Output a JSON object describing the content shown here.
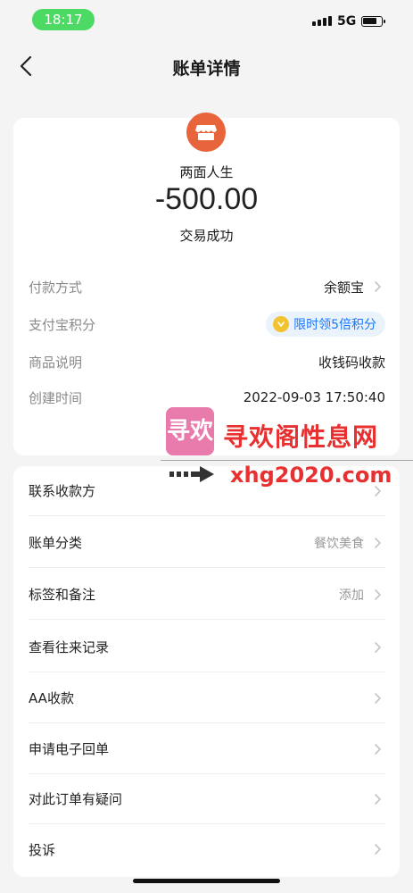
{
  "status_bar": {
    "time": "18:17",
    "network": "5G"
  },
  "nav": {
    "title": "账单详情"
  },
  "transaction": {
    "merchant": "两面人生",
    "amount": "-500.00",
    "status": "交易成功"
  },
  "details": [
    {
      "label": "付款方式",
      "value": "余额宝"
    },
    {
      "label": "支付宝积分",
      "value": "限时领5倍积分"
    },
    {
      "label": "商品说明",
      "value": "收钱码收款"
    },
    {
      "label": "创建时间",
      "value": "2022-09-03 17:50:40"
    }
  ],
  "actions": [
    {
      "label": "联系收款方",
      "value": ""
    },
    {
      "label": "账单分类",
      "value": "餐饮美食"
    },
    {
      "label": "标签和备注",
      "value": "添加"
    },
    {
      "label": "查看往来记录",
      "value": ""
    },
    {
      "label": "AA收款",
      "value": ""
    },
    {
      "label": "申请电子回单",
      "value": ""
    },
    {
      "label": "对此订单有疑问",
      "value": ""
    },
    {
      "label": "投诉",
      "value": ""
    }
  ],
  "watermark": {
    "logo_text": "寻欢",
    "name": "寻欢阁性息网",
    "url": "xhg2020.com"
  },
  "colors": {
    "accent_blue": "#1677ff",
    "merchant_logo": "#e8643a",
    "time_pill": "#4cd964",
    "watermark_red": "#e83030"
  }
}
